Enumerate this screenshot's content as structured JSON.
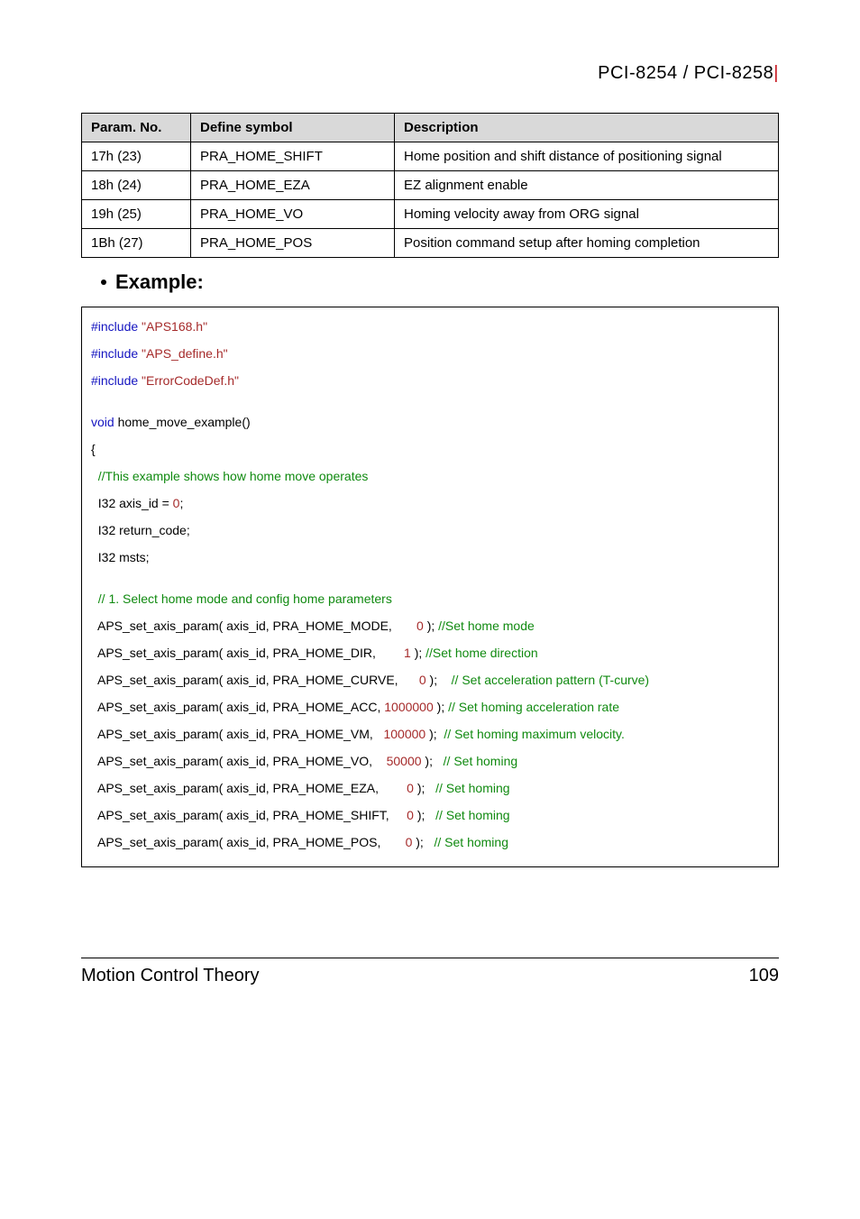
{
  "header": {
    "left": "PCI-8254 / PCI-8258",
    "bar": "|"
  },
  "table": {
    "h0": "Param. No.",
    "h1": "Define symbol",
    "h2": "Description",
    "rows": [
      {
        "c0": "17h (23)",
        "c1": "PRA_HOME_SHIFT",
        "c2": "Home position and shift distance of positioning signal"
      },
      {
        "c0": "18h (24)",
        "c1": "PRA_HOME_EZA",
        "c2": "EZ alignment enable"
      },
      {
        "c0": "19h (25)",
        "c1": "PRA_HOME_VO",
        "c2": "Homing velocity away from ORG signal"
      },
      {
        "c0": "1Bh (27)",
        "c1": "PRA_HOME_POS",
        "c2": "Position command setup after homing completion"
      }
    ]
  },
  "example_label": "Example:",
  "code": {
    "inc1a": "#include",
    "inc1b": " \"APS168.h\"",
    "inc2a": "#include",
    "inc2b": " \"APS_define.h\"",
    "inc3a": "#include",
    "inc3b": " \"ErrorCodeDef.h\"",
    "void": "void",
    "fn": " home_move_example()",
    "brace_open": "{",
    "cmt1": "  //This example shows how home move operates",
    "l_axis_a": "  I32 axis_id = ",
    "l_axis_b": "0",
    "l_axis_c": ";",
    "l_rc": "  I32 return_code;",
    "l_msts": "  I32 msts;",
    "cmt2": "  // 1. Select home mode and config home parameters",
    "p1a": "  APS_set_axis_param( axis_id, PRA_HOME_MODE, ",
    "p1b": "      0",
    "p1c": " ); ",
    "p1d": "//Set home mode",
    "p2a": "  APS_set_axis_param( axis_id, PRA_HOME_DIR, ",
    "p2b": "       1",
    "p2c": " ); ",
    "p2d": "//Set home direction",
    "p3a": "  APS_set_axis_param( axis_id, PRA_HOME_CURVE, ",
    "p3b": "     0",
    "p3c": " );    ",
    "p3d": "// Set acceleration pattern (T-curve)",
    "p4a": "  APS_set_axis_param( axis_id, PRA_HOME_ACC, ",
    "p4b": "1000000",
    "p4c": " ); ",
    "p4d": "// Set homing acceleration rate",
    "p5a": "  APS_set_axis_param( axis_id, PRA_HOME_VM, ",
    "p5b": "  100000",
    "p5c": " );  ",
    "p5d": "// Set homing maximum velocity.",
    "p6a": "  APS_set_axis_param( axis_id, PRA_HOME_VO, ",
    "p6b": "   50000",
    "p6c": " );   ",
    "p6d": "// Set homing",
    "p7a": "  APS_set_axis_param( axis_id, PRA_HOME_EZA, ",
    "p7b": "       0",
    "p7c": " );   ",
    "p7d": "// Set homing",
    "p8a": "  APS_set_axis_param( axis_id, PRA_HOME_SHIFT, ",
    "p8b": "    0",
    "p8c": " );   ",
    "p8d": "// Set homing",
    "p9a": "  APS_set_axis_param( axis_id, PRA_HOME_POS, ",
    "p9b": "      0",
    "p9c": " );   ",
    "p9d": "// Set homing"
  },
  "footer": {
    "left": "Motion Control Theory",
    "right": "109"
  }
}
